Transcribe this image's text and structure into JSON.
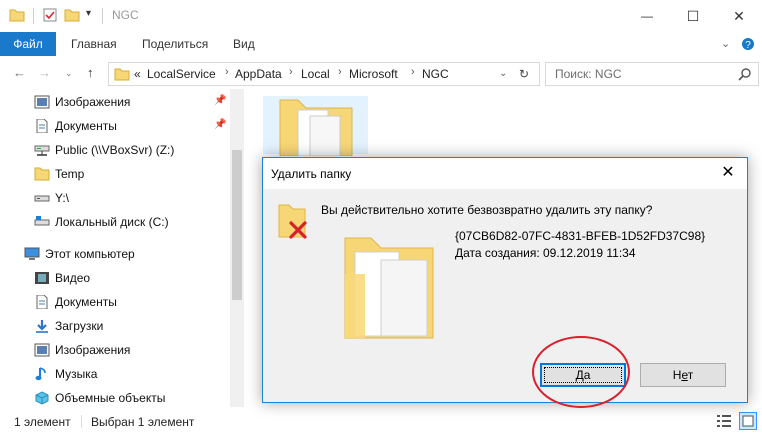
{
  "window": {
    "title": "NGC",
    "controls": {
      "minimize": "—",
      "maximize": "☐",
      "close": "✕"
    }
  },
  "ribbon": {
    "tabs": [
      "Файл",
      "Главная",
      "Поделиться",
      "Вид"
    ],
    "expand_icon": "chevron-down-icon",
    "help_icon": "help-icon"
  },
  "address": {
    "overflow": "«",
    "crumbs": [
      "LocalService",
      "AppData",
      "Local",
      "Microsoft",
      "NGC"
    ],
    "search_placeholder": "Поиск: NGC"
  },
  "nav_pane": {
    "items": [
      {
        "label": "Изображения",
        "icon": "pictures-icon",
        "pinned": true
      },
      {
        "label": "Документы",
        "icon": "documents-icon",
        "pinned": true
      },
      {
        "label": "Public (\\\\VBoxSvr) (Z:)",
        "icon": "network-drive-icon",
        "pinned": false
      },
      {
        "label": "Temp",
        "icon": "folder-icon",
        "pinned": false
      },
      {
        "label": "Y:\\",
        "icon": "drive-icon",
        "pinned": false
      },
      {
        "label": "Локальный диск (C:)",
        "icon": "local-disk-icon",
        "pinned": false
      },
      {
        "label": "Этот компьютер",
        "icon": "computer-icon",
        "pinned": false
      },
      {
        "label": "Видео",
        "icon": "video-icon",
        "pinned": false
      },
      {
        "label": "Документы",
        "icon": "documents-icon",
        "pinned": false
      },
      {
        "label": "Загрузки",
        "icon": "downloads-icon",
        "pinned": false
      },
      {
        "label": "Изображения",
        "icon": "pictures-icon",
        "pinned": false
      },
      {
        "label": "Музыка",
        "icon": "music-icon",
        "pinned": false
      },
      {
        "label": "Объемные объекты",
        "icon": "3d-objects-icon",
        "pinned": false
      }
    ]
  },
  "status": {
    "count": "1 элемент",
    "selected": "Выбран 1 элемент"
  },
  "dialog": {
    "title": "Удалить папку",
    "question": "Вы действительно хотите безвозвратно удалить эту папку?",
    "folder_name": "{07CB6D82-07FC-4831-BFEB-1D52FD37C98}",
    "created": "Дата создания: 09.12.2019 11:34",
    "yes_label_accel": "Д",
    "yes_label_rest": "а",
    "no_label_pre": "Н",
    "no_label_accel": "е",
    "no_label_rest": "т"
  },
  "colors": {
    "accent": "#1979ca",
    "dialog_border": "#1883d7",
    "annotation": "#d9202c",
    "folder": "#f6d675"
  }
}
